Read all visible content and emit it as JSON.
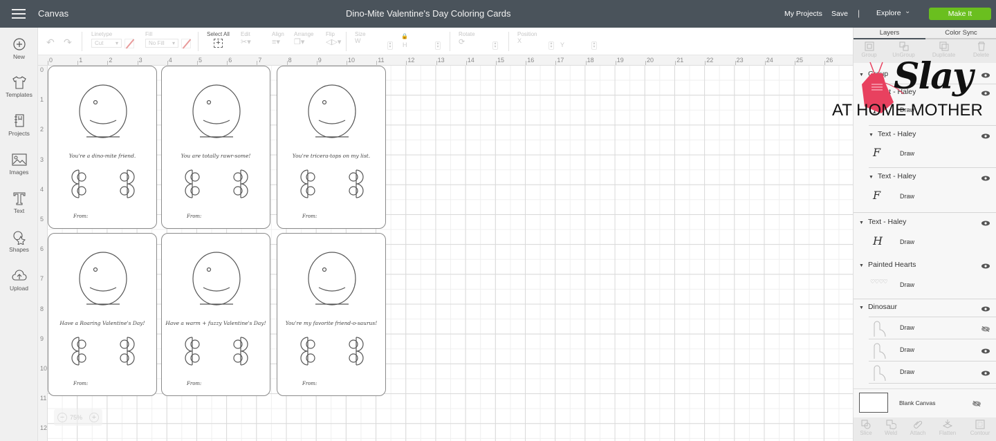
{
  "topbar": {
    "section": "Canvas",
    "project_title": "Dino-Mite Valentine's Day Coloring Cards",
    "my_projects": "My Projects",
    "save": "Save",
    "separator": "|",
    "explore": "Explore",
    "make_it": "Make It",
    "accent_color": "#6abf1f",
    "bar_color": "#4a535b"
  },
  "leftnav": [
    {
      "label": "New",
      "icon": "plus-circle-icon"
    },
    {
      "label": "Templates",
      "icon": "shirt-icon"
    },
    {
      "label": "Projects",
      "icon": "notebook-icon"
    },
    {
      "label": "Images",
      "icon": "image-icon"
    },
    {
      "label": "Text",
      "icon": "text-t-icon"
    },
    {
      "label": "Shapes",
      "icon": "shapes-icon"
    },
    {
      "label": "Upload",
      "icon": "cloud-upload-icon"
    }
  ],
  "toolbar": {
    "linetype_label": "Linetype",
    "linetype_value": "Cut",
    "fill_label": "Fill",
    "fill_value": "No Fill",
    "select_all": "Select All",
    "edit": "Edit",
    "align": "Align",
    "arrange": "Arrange",
    "flip": "Flip",
    "size": "Size",
    "w": "W",
    "h": "H",
    "rotate": "Rotate",
    "position": "Position",
    "x": "X",
    "y": "Y"
  },
  "ruler": {
    "top": [
      "0",
      "1",
      "2",
      "3",
      "4",
      "5",
      "6",
      "7",
      "8",
      "9",
      "10",
      "11",
      "12",
      "13",
      "14",
      "15",
      "16",
      "17",
      "18",
      "19",
      "20",
      "21",
      "22",
      "23",
      "24",
      "25",
      "26"
    ],
    "left": [
      "0",
      "1",
      "2",
      "3",
      "4",
      "5",
      "6",
      "7",
      "8",
      "9",
      "10",
      "11",
      "12"
    ]
  },
  "zoom": {
    "value": "75%",
    "minus": "−",
    "plus": "+"
  },
  "cards": [
    {
      "message": "You're a dino-mite friend.",
      "from": "From:"
    },
    {
      "message": "You are totally rawr-some!",
      "from": "From:"
    },
    {
      "message": "You're tricera-tops on my list.",
      "from": "From:"
    },
    {
      "message": "Have a Roaring Valentine's Day!",
      "from": "From:"
    },
    {
      "message": "Have a warm + fuzzy Valentine's Day!",
      "from": "From:"
    },
    {
      "message": "You're my favorite friend-o-saurus!",
      "from": "From:"
    }
  ],
  "panel": {
    "tabs": [
      "Layers",
      "Color Sync"
    ],
    "tools": [
      "Group",
      "UnGroup",
      "Duplicate",
      "Delete"
    ],
    "layers": [
      {
        "type": "group",
        "label": "Group",
        "visible": true
      },
      {
        "type": "group",
        "label": "Text - Haley",
        "visible": true
      },
      {
        "type": "item",
        "label": "Draw"
      },
      {
        "type": "group",
        "label": "Text - Haley",
        "visible": true
      },
      {
        "type": "item",
        "label": "Draw"
      },
      {
        "type": "group",
        "label": "Text - Haley",
        "visible": true
      },
      {
        "type": "item",
        "label": "Draw"
      },
      {
        "type": "group",
        "label": "Text - Haley",
        "visible": true
      },
      {
        "type": "item",
        "label": "Draw"
      },
      {
        "type": "group",
        "label": "Painted Hearts",
        "visible": true
      },
      {
        "type": "item",
        "label": "Draw"
      },
      {
        "type": "group",
        "label": "Dinosaur",
        "visible": true
      },
      {
        "type": "item",
        "label": "Draw",
        "visible": false
      },
      {
        "type": "item",
        "label": "Draw",
        "visible": true
      },
      {
        "type": "item",
        "label": "Draw",
        "visible": true
      }
    ],
    "blank_canvas": "Blank Canvas",
    "bottom_tools": [
      "Slice",
      "Weld",
      "Attach",
      "Flatten",
      "Contour"
    ]
  },
  "watermark": {
    "title": "Slay",
    "subtitle": "AT HOME MOTHER",
    "apron_color": "#e8415f"
  }
}
